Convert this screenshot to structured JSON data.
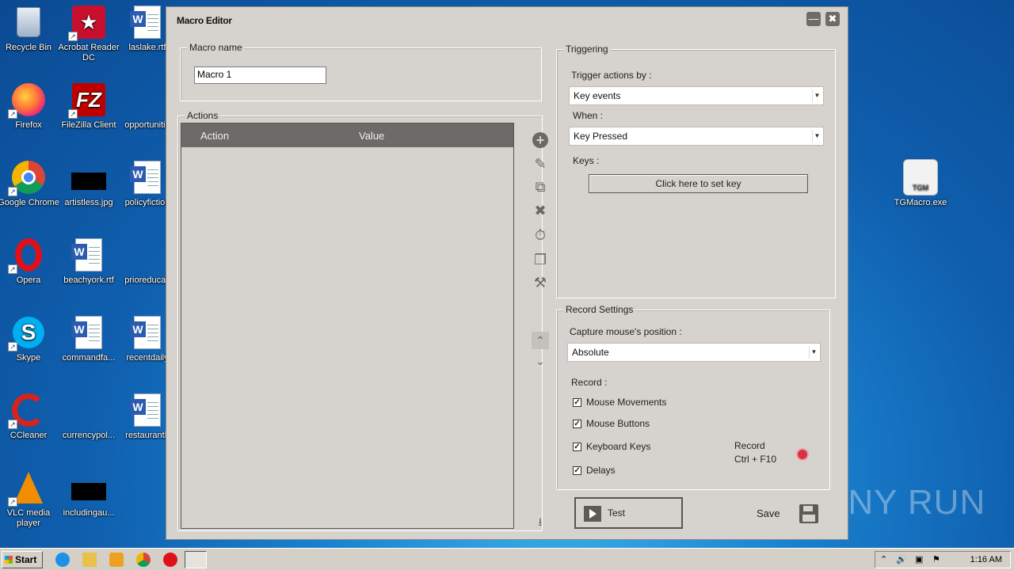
{
  "desktop": {
    "col1": [
      "Recycle Bin",
      "Acrobat Reader DC",
      "laslake.rtf",
      "Firefox",
      "FileZilla Client",
      "opportunitie",
      "Google Chrome",
      "artistless.jpg",
      "policyfiction",
      "Opera",
      "beachyork.rtf",
      "prioreducati",
      "Skype",
      "commandfa...",
      "recentdaily",
      "CCleaner",
      "currencypol...",
      "restaurantb",
      "VLC media player",
      "includingau...",
      "TGMacro.exe"
    ]
  },
  "window": {
    "title": "Macro Editor",
    "minimize": "—",
    "close": "✖"
  },
  "macro_name": {
    "group_label": "Macro name",
    "value": "Macro 1"
  },
  "actions": {
    "group_label": "Actions",
    "col_action": "Action",
    "col_value": "Value"
  },
  "triggering": {
    "group_label": "Triggering",
    "trigger_by_label": "Trigger actions by :",
    "trigger_by_value": "Key events",
    "when_label": "When :",
    "when_value": "Key Pressed",
    "keys_label": "Keys :",
    "set_key_button": "Click here to set key"
  },
  "record_settings": {
    "group_label": "Record Settings",
    "capture_label": "Capture mouse's position :",
    "capture_value": "Absolute",
    "record_label": "Record :",
    "options": [
      "Mouse Movements",
      "Mouse Buttons",
      "Keyboard Keys",
      "Delays"
    ],
    "record_hint_line1": "Record",
    "record_hint_line2": "Ctrl + F10"
  },
  "footer": {
    "test_button": "Test",
    "save_label": "Save"
  },
  "taskbar": {
    "start": "Start",
    "clock": "1:16 AM"
  },
  "watermark": "ANY RUN",
  "colors": {
    "record_dot": "#d9333f",
    "window_bg": "#d6d3ce",
    "table_header": "#6d6b68"
  }
}
